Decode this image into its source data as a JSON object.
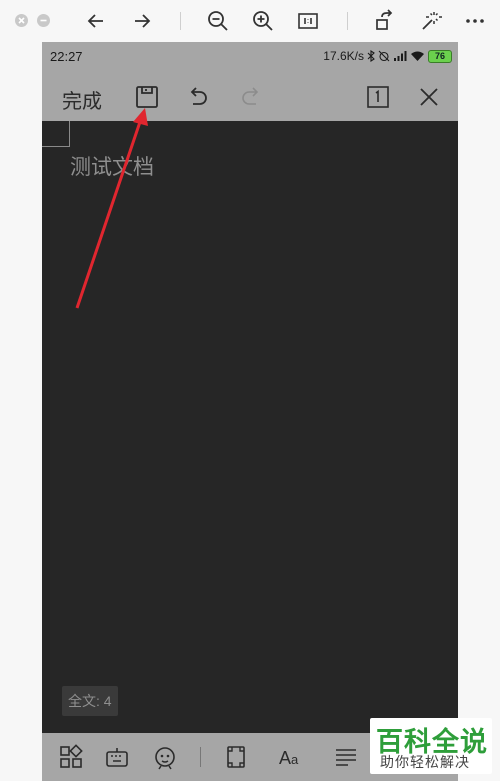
{
  "status_bar": {
    "time": "22:27",
    "speed": "17.6K/s",
    "battery": "76"
  },
  "toolbar": {
    "done_label": "完成"
  },
  "document": {
    "text": "测试文档",
    "word_count": "全文: 4"
  },
  "watermark": {
    "title": "百科全说",
    "subtitle": "助你轻松解决"
  },
  "colors": {
    "bar_bg": "#a6a6a6",
    "doc_bg": "#262626",
    "arrow": "#e0262f",
    "watermark_green": "#2e9e3a"
  }
}
